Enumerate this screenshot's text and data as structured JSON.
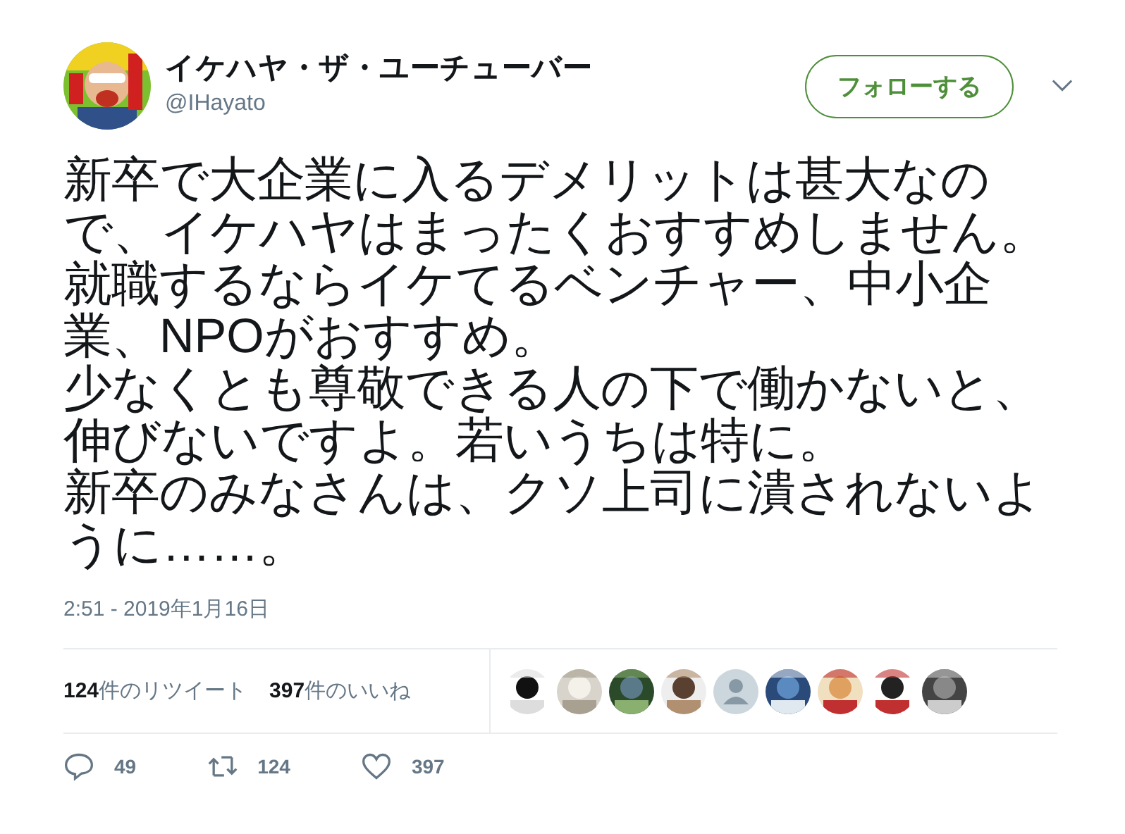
{
  "author": {
    "name": "イケハヤ・ザ・ユーチューバー",
    "handle": "@IHayato"
  },
  "follow_button": "フォローする",
  "text": [
    "新卒で大企業に入るデメリットは甚大なので、イケハヤはまったくおすすめしません。",
    "就職するならイケてるベンチャー、中小企業、NPOがおすすめ。",
    "少なくとも尊敬できる人の下で働かないと、伸びないですよ。若いうちは特に。",
    "新卒のみなさんは、クソ上司に潰されないように……。"
  ],
  "timestamp": "2:51 - 2019年1月16日",
  "stats": [
    {
      "count": "124",
      "label": "件のリツイート"
    },
    {
      "count": "397",
      "label": "件のいいね"
    }
  ],
  "likers": [
    {
      "kind": "picture"
    },
    {
      "kind": "picture"
    },
    {
      "kind": "picture"
    },
    {
      "kind": "picture"
    },
    {
      "kind": "default"
    },
    {
      "kind": "picture"
    },
    {
      "kind": "picture"
    },
    {
      "kind": "picture"
    },
    {
      "kind": "picture"
    }
  ],
  "actions": [
    {
      "kind": "reply",
      "count": "49"
    },
    {
      "kind": "retweet",
      "count": "124"
    },
    {
      "kind": "like",
      "count": "397"
    }
  ]
}
